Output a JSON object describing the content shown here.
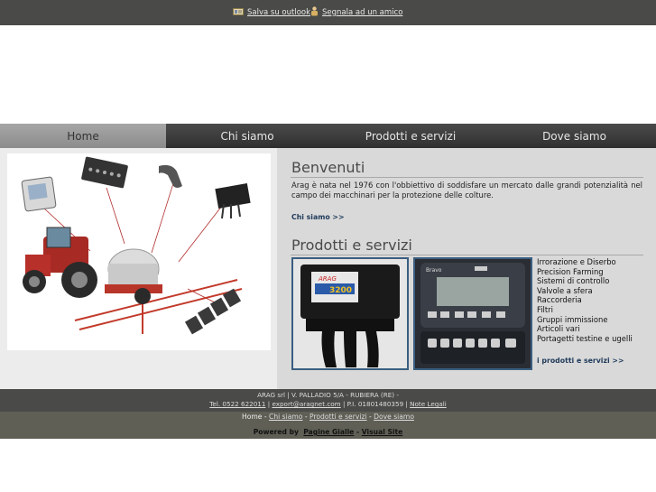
{
  "topbar": {
    "outlook_label": "Salva su outlook",
    "friend_label": "Segnala ad un amico"
  },
  "nav": {
    "items": [
      {
        "label": "Home",
        "active": true
      },
      {
        "label": "Chi siamo",
        "active": false
      },
      {
        "label": "Prodotti e servizi",
        "active": false
      },
      {
        "label": "Dove siamo",
        "active": false
      }
    ]
  },
  "welcome": {
    "title": "Benvenuti",
    "text": "Arag è nata nel 1976 con l'obbiettivo di soddisfare un mercato dalle grandi potenzialità nel campo dei macchinari per la protezione delle colture.",
    "more": "Chi siamo >>"
  },
  "products": {
    "title": "Prodotti e servizi",
    "items": [
      "Irrorazione e Diserbo",
      "Precision Farming",
      "Sistemi di controllo",
      "Valvole a sfera",
      "Raccorderia",
      "Filtri",
      "Gruppi immissione",
      "Articoli vari",
      "Portagetti testine e ugelli"
    ],
    "more": "i prodotti e servizi >>",
    "box1_brand": "ARAG",
    "box1_model": "3200",
    "box2_brand": "Bravo"
  },
  "footer": {
    "address": "ARAG srl | V. PALLADIO 5/A - RUBIERA (RE) -",
    "tel": "Tel. 0522 622011",
    "sep1": " | ",
    "email": "export@aragnet.com",
    "piva": " | P.I. 01801480359 | ",
    "legal": "Note Legali",
    "links": [
      "Home",
      "Chi siamo",
      "Prodotti e servizi",
      "Dove siamo"
    ],
    "link_sep": " - ",
    "powered_prefix": "Powered by",
    "pg": "Pagine Gialle",
    "dash": " - ",
    "vs": "Visual Site"
  },
  "colors": {
    "dark_bar": "#4a4a48",
    "nav_active": "#9a9a9a",
    "accent_blue": "#3a5e80"
  }
}
